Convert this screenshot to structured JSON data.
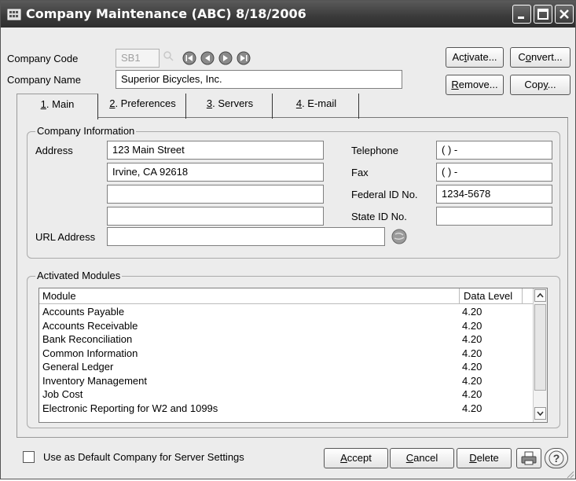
{
  "window": {
    "title": "Company Maintenance (ABC) 8/18/2006"
  },
  "company": {
    "code_label": "Company Code",
    "code_value": "SB1",
    "name_label": "Company Name",
    "name_value": "Superior Bicycles, Inc."
  },
  "actions": {
    "activate": {
      "pre": "Ac",
      "key": "t",
      "post": "ivate..."
    },
    "convert": {
      "pre": "C",
      "key": "o",
      "post": "nvert..."
    },
    "remove": {
      "pre": "",
      "key": "R",
      "post": "emove..."
    },
    "copy": {
      "pre": "Cop",
      "key": "y",
      "post": "..."
    }
  },
  "tabs": [
    {
      "key": "1",
      "label": ". Main"
    },
    {
      "key": "2",
      "label": ". Preferences"
    },
    {
      "key": "3",
      "label": ". Servers"
    },
    {
      "key": "4",
      "label": ". E-mail"
    }
  ],
  "company_info": {
    "group_title": "Company Information",
    "address_label": "Address",
    "address_lines": [
      "123 Main Street",
      "Irvine, CA  92618",
      "",
      ""
    ],
    "url_label": "URL Address",
    "url_value": "",
    "telephone_label": "Telephone",
    "telephone_value": "(  )    -",
    "fax_label": "Fax",
    "fax_value": "(  )    -",
    "federal_id_label": "Federal ID No.",
    "federal_id_value": "1234-5678",
    "state_id_label": "State ID No.",
    "state_id_value": ""
  },
  "modules": {
    "group_title": "Activated Modules",
    "columns": [
      "Module",
      "Data Level"
    ],
    "rows": [
      {
        "module": "Accounts Payable",
        "level": "4.20"
      },
      {
        "module": "Accounts Receivable",
        "level": "4.20"
      },
      {
        "module": "Bank Reconciliation",
        "level": "4.20"
      },
      {
        "module": "Common Information",
        "level": "4.20"
      },
      {
        "module": "General Ledger",
        "level": "4.20"
      },
      {
        "module": "Inventory Management",
        "level": "4.20"
      },
      {
        "module": "Job Cost",
        "level": "4.20"
      },
      {
        "module": "Electronic Reporting for W2 and 1099s",
        "level": "4.20"
      }
    ]
  },
  "footer": {
    "default_label": "Use as Default Company for Server Settings",
    "accept": {
      "pre": "",
      "key": "A",
      "post": "ccept"
    },
    "cancel": {
      "pre": "",
      "key": "C",
      "post": "ancel"
    },
    "delete": {
      "pre": "",
      "key": "D",
      "post": "elete"
    }
  }
}
